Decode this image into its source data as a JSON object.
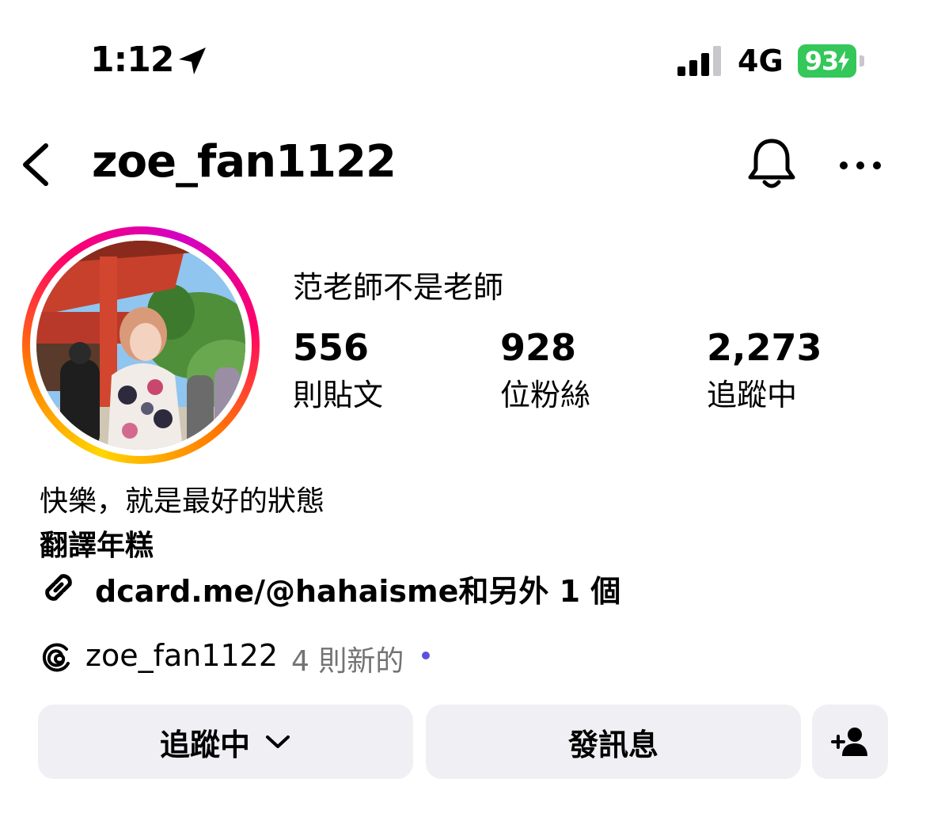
{
  "status_bar": {
    "time": "1:12",
    "network": "4G",
    "battery": "93",
    "location_icon": "location-arrow-icon",
    "signal_icon": "cellular-signal-icon",
    "battery_color": "#34c759"
  },
  "header": {
    "username": "zoe_fan1122",
    "back_icon": "chevron-left-icon",
    "bell_icon": "bell-icon",
    "more_icon": "ellipsis-icon"
  },
  "profile": {
    "display_name": "范老師不是老師",
    "stats": [
      {
        "value": "556",
        "label": "則貼文"
      },
      {
        "value": "928",
        "label": "位粉絲"
      },
      {
        "value": "2,273",
        "label": "追蹤中"
      }
    ],
    "bio_line1": "快樂，就是最好的狀態",
    "bio_line2": "翻譯年糕",
    "link": "dcard.me/@hahaisme和另外 1 個",
    "threads": {
      "name": "zoe_fan1122",
      "new_label": "4 則新的",
      "dot_color": "#5b51de"
    }
  },
  "actions": {
    "follow_label": "追蹤中",
    "message_label": "發訊息",
    "add_icon": "add-person-icon"
  },
  "colors": {
    "button_bg": "#efeff4",
    "story_ring": [
      "#ffd600",
      "#ff7a00",
      "#ff0069",
      "#d300c5"
    ]
  }
}
